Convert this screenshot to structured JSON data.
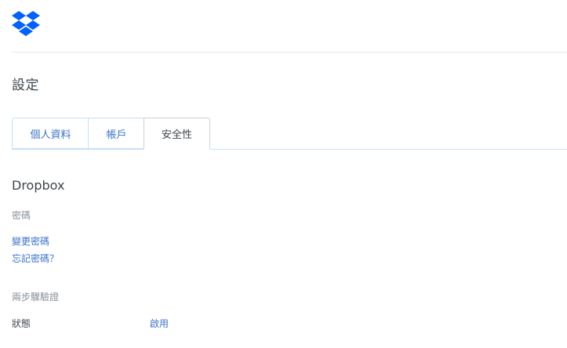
{
  "header": {
    "logo_icon": "dropbox-logo-icon",
    "brand_color": "#0061fe"
  },
  "page": {
    "title": "設定"
  },
  "tabs": [
    {
      "label": "個人資料",
      "active": false
    },
    {
      "label": "帳戶",
      "active": false
    },
    {
      "label": "安全性",
      "active": true
    }
  ],
  "security": {
    "section_title": "Dropbox",
    "password": {
      "heading": "密碼",
      "change_link": "變更密碼",
      "forgot_link": "忘記密碼？"
    },
    "two_step": {
      "heading": "兩步驟驗證",
      "status_label": "狀態",
      "enable_link": "啟用"
    }
  },
  "colors": {
    "link": "#3b73c9",
    "text": "#3d464d",
    "muted": "#8a9299",
    "tab_border": "#c9dff3"
  }
}
